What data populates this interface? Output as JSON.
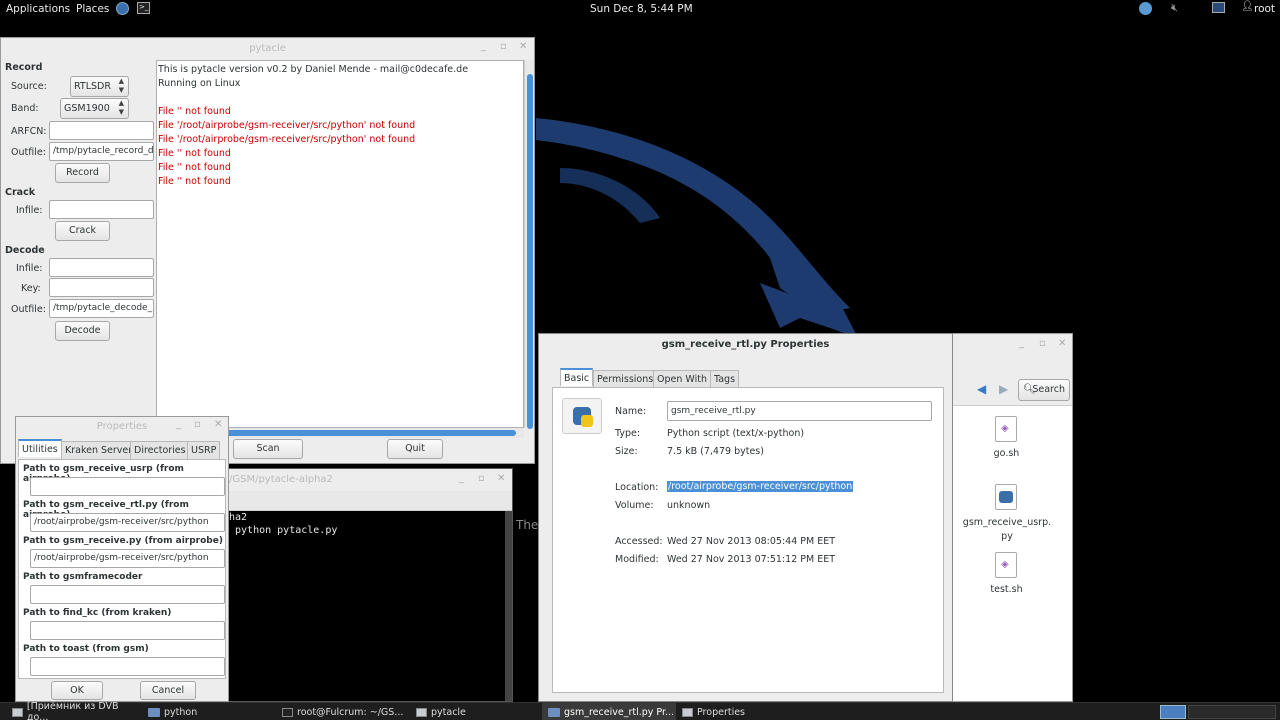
{
  "top_panel": {
    "applications": "Applications",
    "places": "Places",
    "clock": "Sun Dec  8,  5:44 PM",
    "user": "root"
  },
  "desktop": {
    "bg_text": "The"
  },
  "pytacle": {
    "title": "pytacle",
    "record": {
      "heading": "Record",
      "source_label": "Source:",
      "source_value": "RTLSDR",
      "band_label": "Band:",
      "band_value": "GSM1900",
      "arfcn_label": "ARFCN:",
      "arfcn_value": "",
      "outfile_label": "Outfile:",
      "outfile_value": "/tmp/pytacle_record_dl",
      "button": "Record"
    },
    "crack": {
      "heading": "Crack",
      "infile_label": "Infile:",
      "infile_value": "",
      "button": "Crack"
    },
    "decode": {
      "heading": "Decode",
      "infile_label": "Infile:",
      "infile_value": "",
      "key_label": "Key:",
      "key_value": "",
      "outfile_label": "Outfile:",
      "outfile_value": "/tmp/pytacle_decode_M",
      "button": "Decode"
    },
    "log": [
      {
        "text": "This is pytacle version v0.2 by Daniel Mende - mail@c0decafe.de",
        "error": false
      },
      {
        "text": "Running on Linux",
        "error": false
      },
      {
        "text": "",
        "error": false
      },
      {
        "text": "File '' not found",
        "error": true
      },
      {
        "text": "File '/root/airprobe/gsm-receiver/src/python' not found",
        "error": true
      },
      {
        "text": "File '/root/airprobe/gsm-receiver/src/python' not found",
        "error": true
      },
      {
        "text": "File '' not found",
        "error": true
      },
      {
        "text": "File '' not found",
        "error": true
      },
      {
        "text": "File '' not found",
        "error": true
      }
    ],
    "scan_button": "Scan",
    "quit_button": "Quit"
  },
  "properties_dialog": {
    "title": "Properties",
    "tabs": [
      "Utilities",
      "Kraken Server",
      "Directories",
      "USRP"
    ],
    "fields": [
      {
        "label": "Path to gsm_receive_usrp (from airprobe)",
        "value": ""
      },
      {
        "label": "Path to gsm_receive_rtl.py (from airprobe)",
        "value": "/root/airprobe/gsm-receiver/src/python"
      },
      {
        "label": "Path to gsm_receive.py (from airprobe)",
        "value": "/root/airprobe/gsm-receiver/src/python"
      },
      {
        "label": "Path to gsmframecoder",
        "value": ""
      },
      {
        "label": "Path to find_kc (from kraken)",
        "value": ""
      },
      {
        "label": "Path to toast (from gsm)",
        "value": ""
      }
    ],
    "ok": "OK",
    "cancel": "Cancel"
  },
  "terminal": {
    "title": "/GSM/pytacle-alpha2",
    "lines": [
      "ha2",
      " python pytacle.py"
    ]
  },
  "file_props": {
    "title": "gsm_receive_rtl.py Properties",
    "tabs": [
      "Basic",
      "Permissions",
      "Open With",
      "Tags"
    ],
    "name_label": "Name:",
    "name_value": "gsm_receive_rtl.py",
    "type_label": "Type:",
    "type_value": "Python script (text/x-python)",
    "size_label": "Size:",
    "size_value": "7.5 kB (7,479 bytes)",
    "location_label": "Location:",
    "location_value": "/root/airprobe/gsm-receiver/src/python",
    "volume_label": "Volume:",
    "volume_value": "unknown",
    "accessed_label": "Accessed:",
    "accessed_value": "Wed 27 Nov 2013 08:05:44 PM EET",
    "modified_label": "Modified:",
    "modified_value": "Wed 27 Nov 2013 07:51:12 PM EET"
  },
  "file_manager": {
    "search": "Search",
    "files": [
      "go.sh",
      "gsm_receive_usrp.\npy",
      "test.sh"
    ]
  },
  "taskbar": {
    "items": [
      "[Приёмник из DVB до...",
      "python",
      "root@Fulcrum: ~/GS...",
      "pytacle",
      "gsm_receive_rtl.py Pr...",
      "Properties"
    ]
  },
  "colors": {
    "accent": "#4a90d9",
    "error": "#cc0000",
    "dragon": "#1d3b6e"
  }
}
